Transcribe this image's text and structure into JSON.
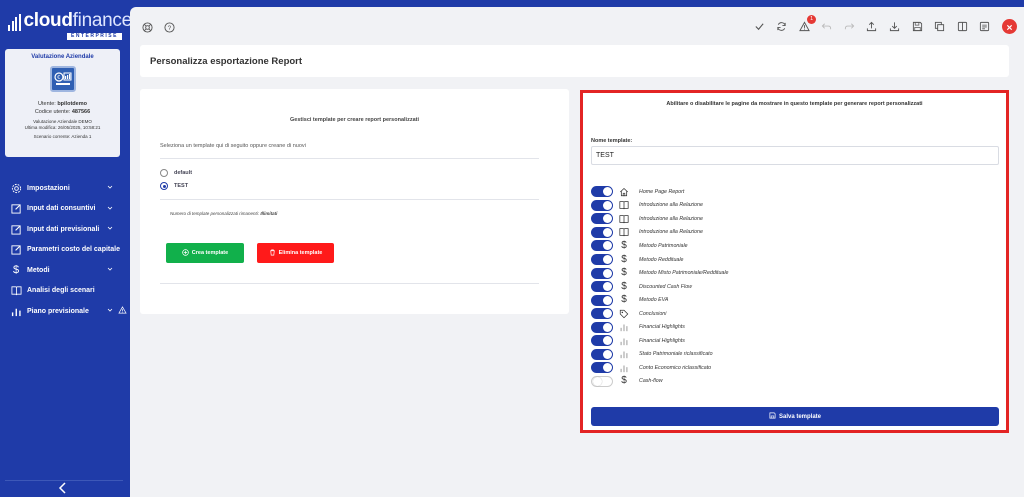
{
  "logo": {
    "bold": "cloud",
    "light": "finance",
    "sub": "ENTERPRISE"
  },
  "company_card": {
    "title": "Valutazione Aziendale",
    "user_label": "Utente:",
    "user": "bpilotdemo",
    "code_label": "Codice utente:",
    "code": "487566",
    "report": "Valutazione Aziendale DEMO",
    "modified": "Ultima modifica: 26/05/2025, 10:58:21",
    "scenario": "Scenario corrente: Azienda 1"
  },
  "sidebar": {
    "items": [
      {
        "label": "Impostazioni",
        "icon": "gear-icon",
        "chevron": true
      },
      {
        "label": "Input dati consuntivi",
        "icon": "edit-icon",
        "chevron": true
      },
      {
        "label": "Input dati previsionali",
        "icon": "edit-icon",
        "chevron": true
      },
      {
        "label": "Parametri costo del capitale",
        "icon": "edit-icon",
        "chevron": false
      },
      {
        "label": "Metodi",
        "icon": "dollar-icon",
        "chevron": true
      },
      {
        "label": "Analisi degli scenari",
        "icon": "book-icon",
        "chevron": false
      },
      {
        "label": "Piano previsionale",
        "icon": "bar-chart-icon",
        "chevron": true,
        "warning": true
      }
    ]
  },
  "topbar": {
    "notification_count": "1"
  },
  "page": {
    "title": "Personalizza esportazione Report"
  },
  "left_panel": {
    "heading": "Gestisci template per creare report personalizzati",
    "hint": "Seleziona un template qui di seguito oppure creane di nuovi",
    "templates": [
      {
        "label": "default",
        "selected": false
      },
      {
        "label": "TEST",
        "selected": true
      }
    ],
    "count_label": "Numero di template personalizzati rimanenti:",
    "count_value": "Illimitati",
    "create_label": "Crea template",
    "delete_label": "Elimina template"
  },
  "right_panel": {
    "heading": "Abilitare o disabilitare le pagine da mostrare in questo template per generare report personalizzati",
    "name_label": "Nome template:",
    "name_value": "TEST",
    "pages": [
      {
        "label": "Home Page Report",
        "icon": "home-icon",
        "enabled": true
      },
      {
        "label": "Introduzione alla Relazione",
        "icon": "book-icon",
        "enabled": true
      },
      {
        "label": "Introduzione alla Relazione",
        "icon": "book-icon",
        "enabled": true
      },
      {
        "label": "Introduzione alla Relazione",
        "icon": "book-icon",
        "enabled": true
      },
      {
        "label": "Metodo Patrimoniale",
        "icon": "dollar-icon",
        "enabled": true
      },
      {
        "label": "Metodo Reddituale",
        "icon": "dollar-icon",
        "enabled": true
      },
      {
        "label": "Metodo Misto Patrimoniale/Reddituale",
        "icon": "dollar-icon",
        "enabled": true
      },
      {
        "label": "Discounted Cash Flow",
        "icon": "dollar-icon",
        "enabled": true
      },
      {
        "label": "Metodo EVA",
        "icon": "dollar-icon",
        "enabled": true
      },
      {
        "label": "Conclusioni",
        "icon": "tag-icon",
        "enabled": true
      },
      {
        "label": "Financial Highlights",
        "icon": "bar-chart-icon",
        "enabled": true
      },
      {
        "label": "Financial Highlights",
        "icon": "bar-chart-icon",
        "enabled": true
      },
      {
        "label": "Stato Patrimoniale riclassificato",
        "icon": "bar-chart-icon",
        "enabled": true
      },
      {
        "label": "Conto Economico riclassificato",
        "icon": "bar-chart-icon",
        "enabled": true
      },
      {
        "label": "Cash-flow",
        "icon": "dollar-icon",
        "enabled": false
      }
    ],
    "save_label": "Salva template"
  },
  "colors": {
    "brand": "#1f3ba8",
    "green": "#11b04b",
    "red": "#ff1a1a",
    "highlight_border": "#e32424"
  }
}
